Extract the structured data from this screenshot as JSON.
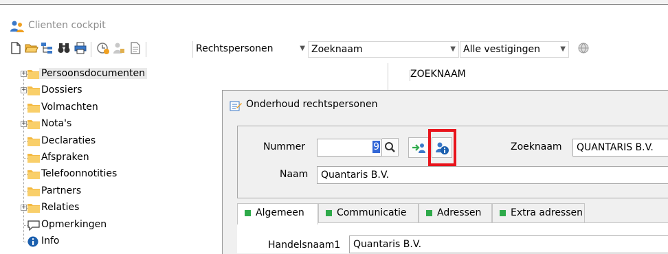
{
  "window": {
    "title": "Clienten cockpit"
  },
  "toolbar": {
    "combo_type": "Rechtspersonen",
    "combo_search": "Zoeknaam",
    "combo_branch": "Alle vestigingen"
  },
  "tree": {
    "items": [
      {
        "label": "Persoonsdocumenten",
        "expandable": true,
        "selected": true
      },
      {
        "label": "Dossiers",
        "expandable": true
      },
      {
        "label": "Volmachten",
        "expandable": false
      },
      {
        "label": "Nota's",
        "expandable": true
      },
      {
        "label": "Declaraties",
        "expandable": false
      },
      {
        "label": "Afspraken",
        "expandable": false
      },
      {
        "label": "Telefoonnotities",
        "expandable": false
      },
      {
        "label": "Partners",
        "expandable": false
      },
      {
        "label": "Relaties",
        "expandable": true
      },
      {
        "label": "Opmerkingen",
        "expandable": false
      },
      {
        "label": "Info",
        "expandable": false
      }
    ]
  },
  "list": {
    "column_header": "ZOEKNAAM"
  },
  "dialog": {
    "title": "Onderhoud rechtspersonen",
    "nummer_label": "Nummer",
    "nummer_value": "9",
    "zoeknaam_label": "Zoeknaam",
    "zoeknaam_value": "QUANTARIS B.V.",
    "naam_label": "Naam",
    "naam_value": "Quantaris B.V.",
    "tabs": [
      "Algemeen",
      "Communicatie",
      "Adressen",
      "Extra adressen"
    ],
    "handelsnaam_label": "Handelsnaam1",
    "handelsnaam_value": "Quantaris B.V."
  },
  "colors": {
    "highlight": "#e8141c",
    "tab_marker": "#2eaa4a",
    "folder": "#f4b942",
    "info_blue": "#1b5fae"
  }
}
